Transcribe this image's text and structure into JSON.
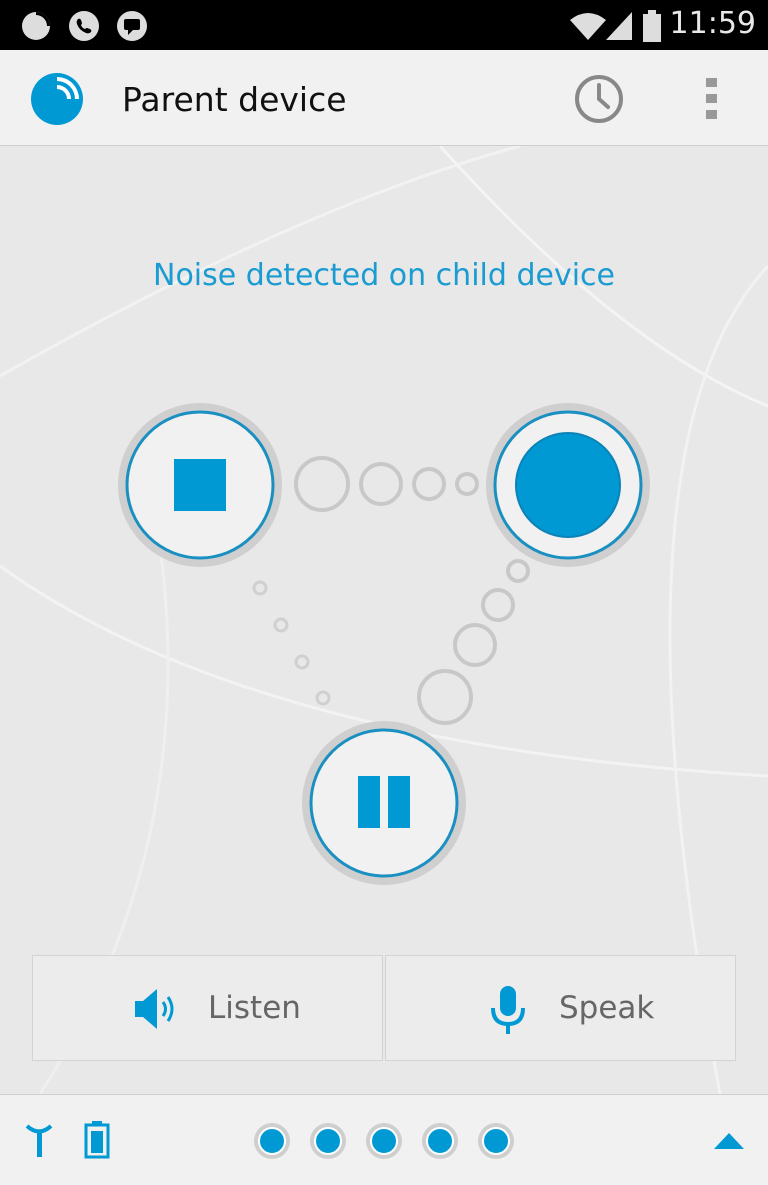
{
  "status_bar": {
    "time": "11:59",
    "icons": [
      "pie-chart-icon",
      "phone-icon",
      "chat-icon",
      "wifi-icon",
      "signal-icon",
      "battery-icon"
    ]
  },
  "app_bar": {
    "title": "Parent device",
    "logo_icon": "baby-monitor-logo-icon",
    "history_icon": "clock-icon",
    "menu_icon": "overflow-menu-icon"
  },
  "main": {
    "status_message": "Noise detected on child device",
    "controls": {
      "stop": "stop-icon",
      "record": "record-icon",
      "pause": "pause-icon"
    }
  },
  "actions": {
    "listen_label": "Listen",
    "speak_label": "Speak",
    "listen_icon": "speaker-icon",
    "speak_icon": "microphone-icon"
  },
  "bottom_bar": {
    "signal_icon": "antenna-icon",
    "battery_icon": "battery-icon",
    "page_dots": 5,
    "expand_icon": "triangle-up-icon"
  },
  "colors": {
    "accent": "#0099d4",
    "text_accent": "#1a9bd1",
    "background": "#e8e8e8",
    "bar": "#f1f1f1"
  }
}
